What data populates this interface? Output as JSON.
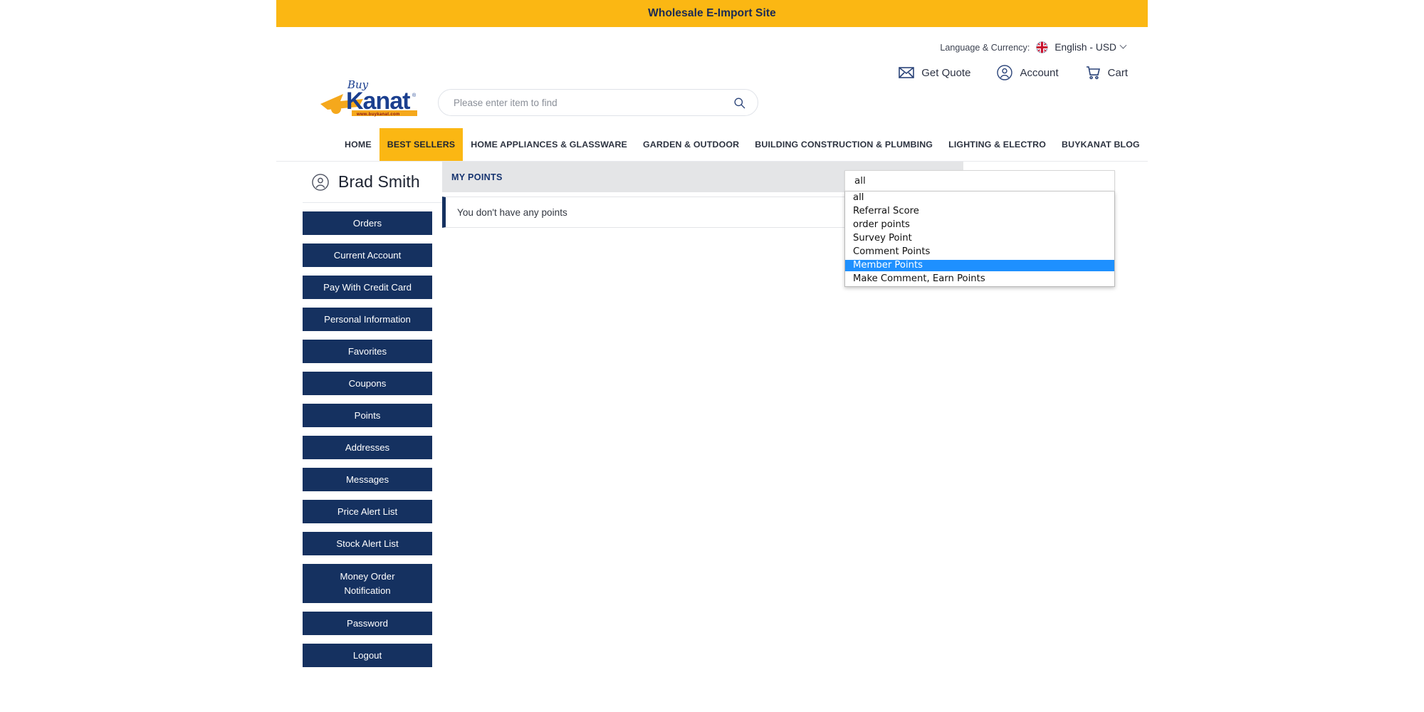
{
  "banner": {
    "text": "Wholesale E-Import Site"
  },
  "header": {
    "logo_alt": "BuyKanat",
    "logo_word_buy": "Buy",
    "logo_word_main": "Kanat",
    "logo_url_text": "www.buykanat.com",
    "search": {
      "placeholder": "Please enter item to find",
      "value": "",
      "icon": "search-icon"
    },
    "language": {
      "label": "Language & Currency:",
      "flag": "uk-flag-icon",
      "value": "English - USD",
      "chevron": "chevron-down-icon"
    },
    "actions": [
      {
        "label": "Get Quote",
        "icon": "envelope-icon"
      },
      {
        "label": "Account",
        "icon": "user-circle-icon"
      },
      {
        "label": "Cart",
        "icon": "cart-icon"
      }
    ]
  },
  "nav": {
    "items": [
      {
        "label": "HOME",
        "active": false
      },
      {
        "label": "BEST SELLERS",
        "active": true
      },
      {
        "label": "HOME APPLIANCES & GLASSWARE",
        "active": false
      },
      {
        "label": "GARDEN & OUTDOOR",
        "active": false
      },
      {
        "label": "BUILDING CONSTRUCTION & PLUMBING",
        "active": false
      },
      {
        "label": "LIGHTING & ELECTRO",
        "active": false
      },
      {
        "label": "BUYKANAT BLOG",
        "active": false
      }
    ]
  },
  "sidebar": {
    "user_name": "Brad Smith",
    "user_icon": "user-circle-icon",
    "items": [
      {
        "label": "Orders"
      },
      {
        "label": "Current Account"
      },
      {
        "label": "Pay With Credit Card"
      },
      {
        "label": "Personal Information"
      },
      {
        "label": "Favorites"
      },
      {
        "label": "Coupons"
      },
      {
        "label": "Points"
      },
      {
        "label": "Addresses"
      },
      {
        "label": "Messages"
      },
      {
        "label": "Price Alert List"
      },
      {
        "label": "Stock Alert List"
      },
      {
        "label": "Money Order",
        "label2": "Notification"
      },
      {
        "label": "Password"
      },
      {
        "label": "Logout"
      }
    ]
  },
  "content": {
    "panel_title": "MY POINTS",
    "empty_message": "You don't have any points"
  },
  "points_filter": {
    "selected_value": "all",
    "highlighted_option": "Member Points",
    "options": [
      "all",
      "Referral Score",
      "order points",
      "Survey Point",
      "Comment Points",
      "Member Points",
      "Make Comment, Earn Points"
    ]
  },
  "colors": {
    "banner_yellow": "#fbb713",
    "navy": "#153160",
    "panel_head_gray": "#e4e5e7",
    "title_blue": "#163470",
    "select_highlight": "#1e90ff"
  }
}
